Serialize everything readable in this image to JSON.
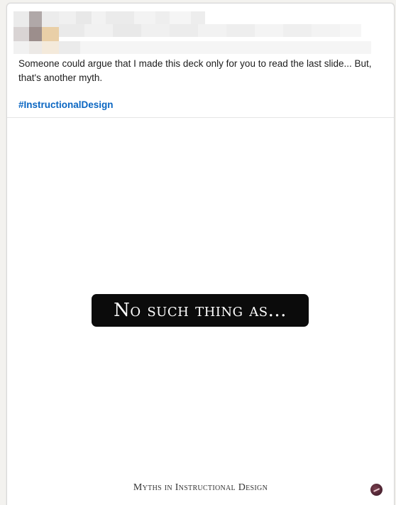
{
  "post": {
    "body_text": "Someone could argue that I made this deck only for you to read the last slide... But, that's another myth.",
    "hashtag": "#InstructionalDesign"
  },
  "slide": {
    "headline": "No such thing as...",
    "footer": "Myths in Instructional Design",
    "logo_icon": "brand-logo-icon",
    "colors": {
      "banner_background": "#0b0b0b",
      "banner_text": "#ffffff",
      "hashtag_link": "#0a66c2"
    }
  }
}
